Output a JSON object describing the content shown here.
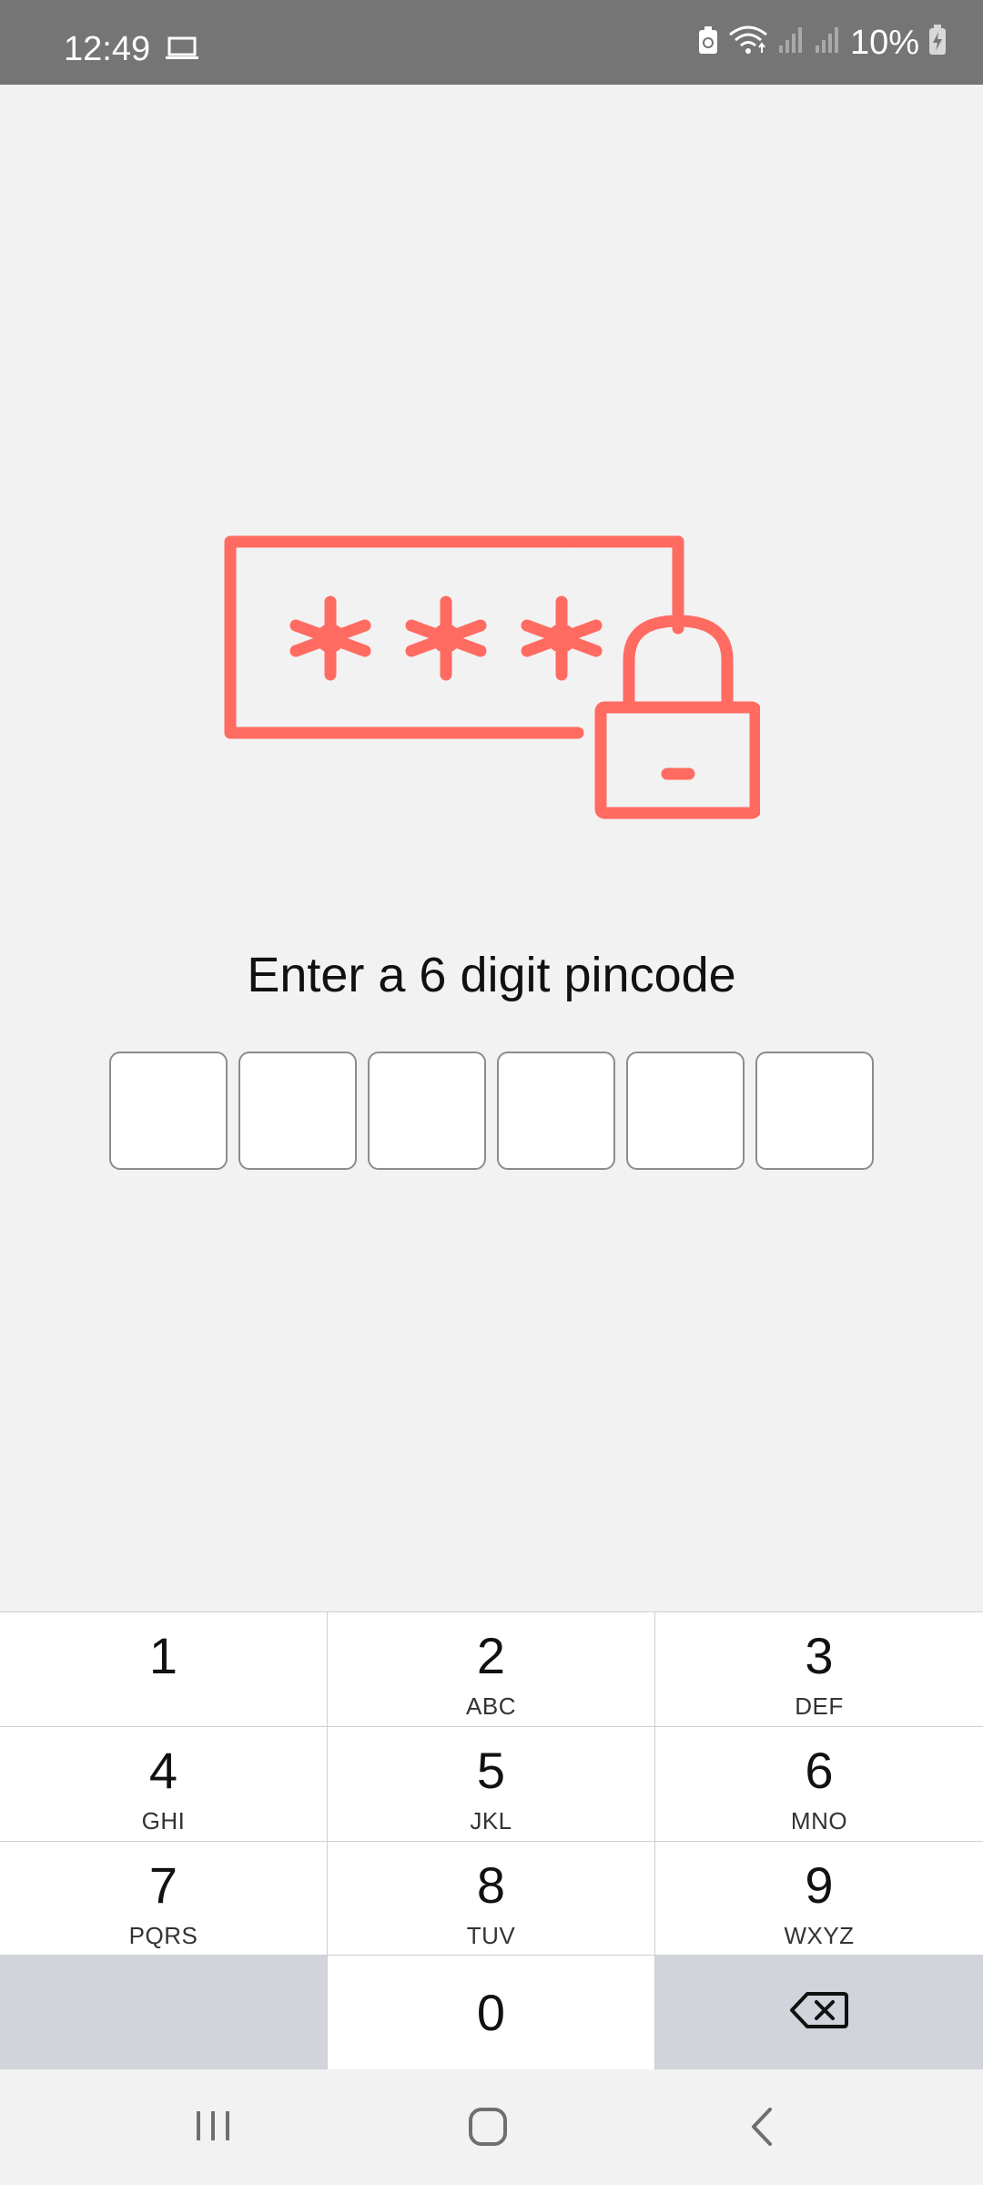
{
  "status_bar": {
    "time": "12:49",
    "battery_percent": "10%",
    "icons": [
      "laptop-icon",
      "battery-saver-icon",
      "wifi-icon",
      "signal-icon",
      "signal-icon",
      "battery-charging-icon"
    ]
  },
  "illustration": {
    "icon": "password-lock-icon",
    "accent_color": "#ff6b61"
  },
  "prompt": {
    "title": "Enter a 6 digit pincode"
  },
  "pin_boxes": [
    "",
    "",
    "",
    "",
    "",
    ""
  ],
  "keypad": {
    "keys": [
      {
        "digit": "1",
        "letters": ""
      },
      {
        "digit": "2",
        "letters": "ABC"
      },
      {
        "digit": "3",
        "letters": "DEF"
      },
      {
        "digit": "4",
        "letters": "GHI"
      },
      {
        "digit": "5",
        "letters": "JKL"
      },
      {
        "digit": "6",
        "letters": "MNO"
      },
      {
        "digit": "7",
        "letters": "PQRS"
      },
      {
        "digit": "8",
        "letters": "TUV"
      },
      {
        "digit": "9",
        "letters": "WXYZ"
      }
    ],
    "zero": "0",
    "backspace_icon": "backspace-icon"
  },
  "nav_bar": {
    "icons": [
      "recents-icon",
      "home-icon",
      "back-icon"
    ]
  }
}
